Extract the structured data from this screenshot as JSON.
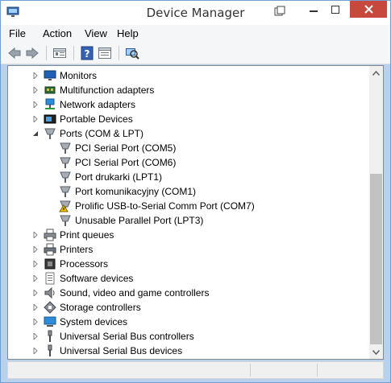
{
  "window": {
    "title": "Device Manager",
    "accent": "#c7493e"
  },
  "menu": {
    "items": [
      "File",
      "Action",
      "View",
      "Help"
    ]
  },
  "toolbar": {
    "buttons": [
      "back-icon",
      "forward-icon",
      "properties-icon",
      "help-icon",
      "show-hide-icon",
      "scan-hardware-icon"
    ]
  },
  "tree": {
    "items": [
      {
        "label": "Monitors",
        "icon": "monitor-icon",
        "expanded": false,
        "level": 0
      },
      {
        "label": "Multifunction adapters",
        "icon": "multifunction-adapter-icon",
        "expanded": false,
        "level": 0
      },
      {
        "label": "Network adapters",
        "icon": "network-adapter-icon",
        "expanded": false,
        "level": 0
      },
      {
        "label": "Portable Devices",
        "icon": "portable-device-icon",
        "expanded": false,
        "level": 0
      },
      {
        "label": "Ports (COM & LPT)",
        "icon": "port-icon",
        "expanded": true,
        "level": 0
      },
      {
        "label": "PCI Serial Port (COM5)",
        "icon": "port-icon",
        "level": 1
      },
      {
        "label": "PCI Serial Port (COM6)",
        "icon": "port-icon",
        "level": 1
      },
      {
        "label": "Port drukarki (LPT1)",
        "icon": "port-icon",
        "level": 1
      },
      {
        "label": "Port komunikacyjny (COM1)",
        "icon": "port-icon",
        "level": 1
      },
      {
        "label": "Prolific USB-to-Serial Comm Port (COM7)",
        "icon": "port-warning-icon",
        "level": 1
      },
      {
        "label": "Unusable Parallel Port (LPT3)",
        "icon": "port-icon",
        "level": 1
      },
      {
        "label": "Print queues",
        "icon": "print-queue-icon",
        "expanded": false,
        "level": 0
      },
      {
        "label": "Printers",
        "icon": "printer-icon",
        "expanded": false,
        "level": 0
      },
      {
        "label": "Processors",
        "icon": "processor-icon",
        "expanded": false,
        "level": 0
      },
      {
        "label": "Software devices",
        "icon": "software-device-icon",
        "expanded": false,
        "level": 0
      },
      {
        "label": "Sound, video and game controllers",
        "icon": "sound-icon",
        "expanded": false,
        "level": 0
      },
      {
        "label": "Storage controllers",
        "icon": "storage-controller-icon",
        "expanded": false,
        "level": 0
      },
      {
        "label": "System devices",
        "icon": "system-device-icon",
        "expanded": false,
        "level": 0
      },
      {
        "label": "Universal Serial Bus controllers",
        "icon": "usb-icon",
        "expanded": false,
        "level": 0
      },
      {
        "label": "Universal Serial Bus devices",
        "icon": "usb-icon",
        "expanded": false,
        "level": 0
      }
    ]
  }
}
